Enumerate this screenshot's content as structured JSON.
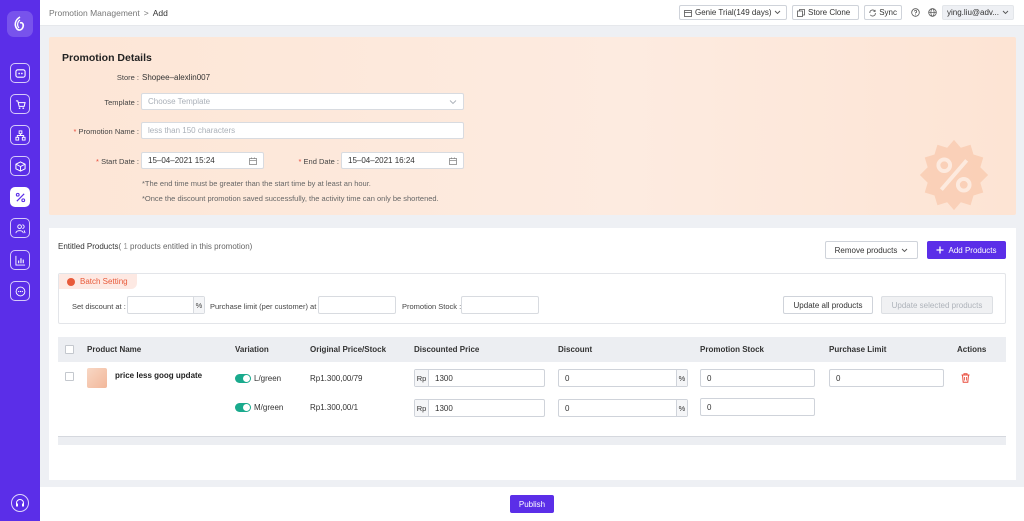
{
  "breadcrumb": {
    "parent": "Promotion Management",
    "separator": ">",
    "current": "Add"
  },
  "topbar": {
    "plan_label": "Genie Trial(149 days)",
    "store_clone_label": "Store Clone",
    "sync_label": "Sync",
    "user_label": "ying.liu@adv..."
  },
  "sidebar": {
    "items": [
      {
        "icon": "dashboard-icon",
        "active": false
      },
      {
        "icon": "cart-icon",
        "active": false
      },
      {
        "icon": "hierarchy-icon",
        "active": false
      },
      {
        "icon": "package-icon",
        "active": false
      },
      {
        "icon": "percent-icon",
        "active": true
      },
      {
        "icon": "users-icon",
        "active": false
      },
      {
        "icon": "chart-icon",
        "active": false
      },
      {
        "icon": "chat-icon",
        "active": false
      }
    ],
    "bottom_icon": "headset-icon"
  },
  "details": {
    "title": "Promotion Details",
    "store_label": "Store",
    "store_value": "Shopee–alexlin007",
    "template_label": "Template",
    "template_placeholder": "Choose Template",
    "name_label": "Promotion Name",
    "name_placeholder": "less than 150 characters",
    "start_label": "Start Date",
    "start_value": "15–04–2021 15:24",
    "end_label": "End Date",
    "end_value": "15–04–2021 16:24",
    "note1": "*The end time must be greater than the start time by at least an hour.",
    "note2": "*Once the discount promotion saved successfully, the activity time can only be shortened."
  },
  "products": {
    "title": "Entitled Products",
    "count_prefix": "( ",
    "count": "1",
    "count_suffix": " products entitled in this promotion)",
    "remove_label": "Remove products",
    "add_label": "Add Products",
    "batch": {
      "tab_label": "Batch Setting",
      "discount_label": "Set discount at :",
      "discount_suffix": "%",
      "limit_label": "Purchase limit (per customer) at :",
      "stock_label": "Promotion Stock :",
      "update_all_label": "Update all products",
      "update_selected_label": "Update selected products"
    },
    "columns": [
      "Product Name",
      "Variation",
      "Original Price/Stock",
      "Discounted Price",
      "Discount",
      "Promotion Stock",
      "Purchase Limit",
      "Actions"
    ],
    "product_name": "price less goog update",
    "rows": [
      {
        "variation": "L/green",
        "original": "Rp1.300,00/79",
        "currency": "Rp",
        "discounted": "1300",
        "discount": "0",
        "discount_suffix": "%",
        "stock": "0",
        "limit": "0"
      },
      {
        "variation": "M/green",
        "original": "Rp1.300,00/1",
        "currency": "Rp",
        "discounted": "1300",
        "discount": "0",
        "discount_suffix": "%",
        "stock": "0"
      }
    ]
  },
  "footer": {
    "publish_label": "Publish"
  },
  "colors": {
    "brand": "#5b2ee8",
    "accent_red": "#e84a3a",
    "toggle_on": "#1aaa8d"
  }
}
